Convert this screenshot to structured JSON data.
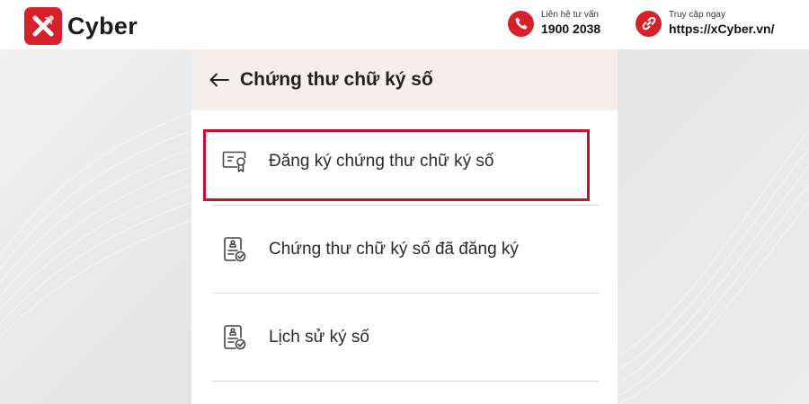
{
  "brand": {
    "name": "Cyber",
    "tm": "TM"
  },
  "header": {
    "hotline_label": "Liên hệ tư vấn",
    "hotline_number": "1900 2038",
    "website_label": "Truy cập ngay",
    "website_url": "https://xCyber.vn/"
  },
  "screen": {
    "title": "Chứng thư chữ ký số",
    "menu": [
      {
        "label": "Đăng ký chứng thư chữ ký số",
        "icon": "certificate-icon",
        "highlighted": true
      },
      {
        "label": "Chứng thư chữ ký số đã đăng ký",
        "icon": "document-check-icon"
      },
      {
        "label": "Lịch sử ký số",
        "icon": "document-check-icon"
      }
    ]
  },
  "colors": {
    "brand_red": "#d6202a",
    "highlight_border": "#c8102e",
    "header_bg": "#f4efeb"
  }
}
